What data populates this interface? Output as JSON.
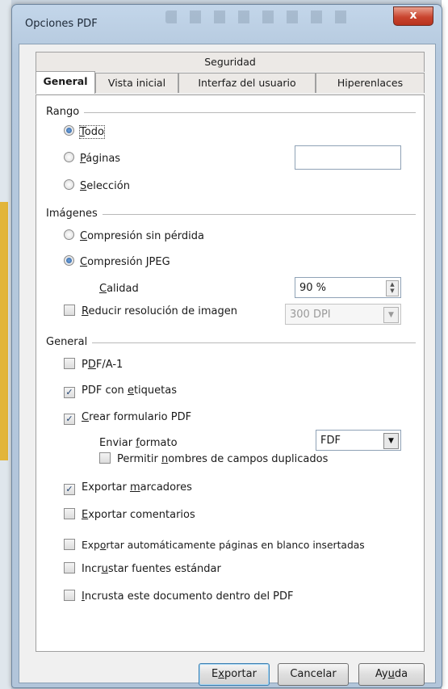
{
  "window": {
    "title": "Opciones PDF",
    "close_label": "x"
  },
  "tabs": {
    "row1": [
      "Seguridad"
    ],
    "row2": [
      "General",
      "Vista inicial",
      "Interfaz del usuario",
      "Hiperenlaces"
    ]
  },
  "rango": {
    "heading": "Rango",
    "options": [
      {
        "pre": "",
        "key": "T",
        "rest": "odo"
      },
      {
        "pre": "",
        "key": "P",
        "rest": "áginas"
      },
      {
        "pre": "",
        "key": "S",
        "rest": "elección"
      }
    ],
    "selected": "Todo",
    "paginas_value": ""
  },
  "imagenes": {
    "heading": "Imágenes",
    "options": [
      {
        "pre": "",
        "key": "C",
        "rest": "ompresión sin pérdida"
      },
      {
        "pre": "",
        "key": "C",
        "rest": "ompresión JPEG"
      }
    ],
    "selected": "Compresión JPEG",
    "calidad": {
      "key": "C",
      "rest": "alidad",
      "value": "90 %"
    },
    "reducir": {
      "key": "R",
      "rest": "educir resolución de imagen",
      "checked": false,
      "value": "300 DPI"
    }
  },
  "general": {
    "heading": "General",
    "items": [
      {
        "pre": "P",
        "key": "D",
        "rest": "F/A-1",
        "checked": false
      },
      {
        "pre": "PDF con ",
        "key": "e",
        "rest": "tiquetas",
        "checked": true
      },
      {
        "pre": "",
        "key": "C",
        "rest": "rear formulario PDF",
        "checked": true
      }
    ],
    "enviar": {
      "pre": "Enviar ",
      "key": "f",
      "rest": "ormato",
      "value": "FDF"
    },
    "permitir": {
      "pre": "Permitir ",
      "key": "n",
      "rest": "ombres de campos duplicados",
      "checked": false
    },
    "items2": [
      {
        "pre": "Exportar ",
        "key": "m",
        "rest": "arcadores",
        "checked": true
      },
      {
        "pre": "",
        "key": "E",
        "rest": "xportar comentarios",
        "checked": false
      },
      {
        "pre": "Exp",
        "key": "o",
        "rest": "rtar automáticamente páginas en blanco insertadas",
        "checked": false
      },
      {
        "pre": "Incr",
        "key": "u",
        "rest": "star fuentes estándar",
        "checked": false
      },
      {
        "pre": "",
        "key": "I",
        "rest": "ncrusta este documento dentro del PDF",
        "checked": false
      }
    ]
  },
  "buttons": [
    {
      "pre": "E",
      "key": "x",
      "rest": "portar"
    },
    {
      "pre": "Cancelar",
      "key": "",
      "rest": ""
    },
    {
      "pre": "Ay",
      "key": "u",
      "rest": "da"
    }
  ],
  "check_glyph": "✓",
  "colors": {
    "accent": "#2d5f9e",
    "close": "#c9452f",
    "window_frame": "#b5c9de"
  }
}
